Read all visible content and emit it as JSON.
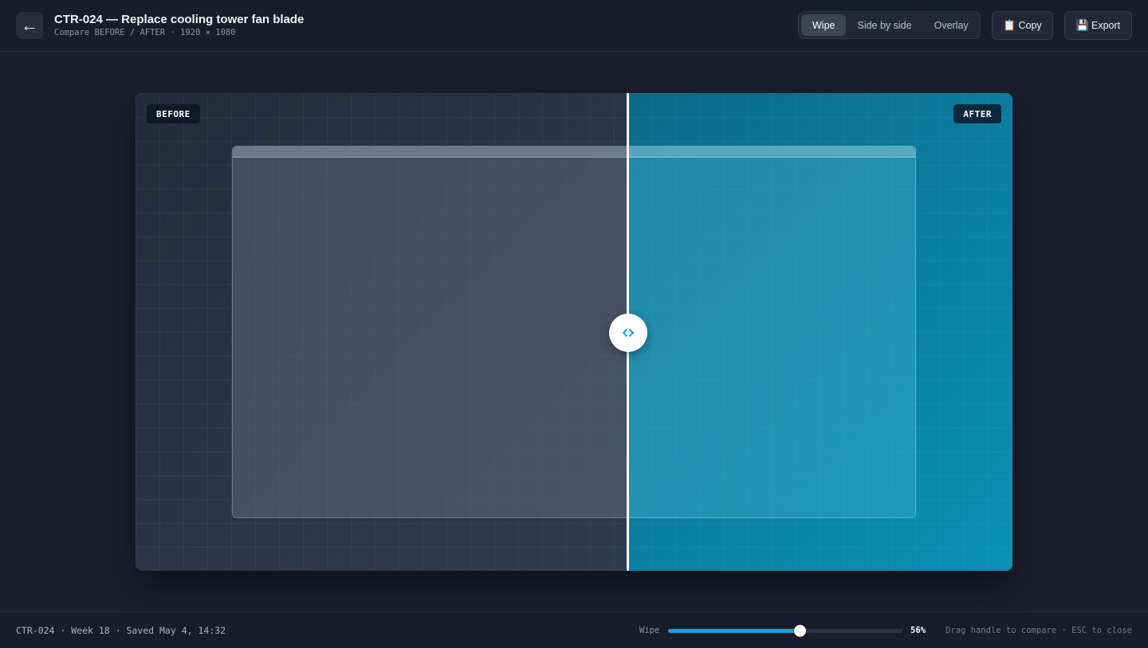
{
  "header": {
    "back_icon": "arrow-left-icon",
    "back_glyph": "←",
    "title": "CTR-024 — Replace cooling tower fan blade",
    "subtitle": "Compare BEFORE / AFTER · 1920 × 1080",
    "modes": [
      {
        "label": "Wipe",
        "active": true
      },
      {
        "label": "Side by side",
        "active": false
      },
      {
        "label": "Overlay",
        "active": false
      }
    ],
    "copy_icon": "clipboard-icon",
    "copy_glyph": "📋",
    "copy_label": "Copy",
    "export_icon": "floppy-disk-icon",
    "export_glyph": "💾",
    "export_label": "Export"
  },
  "stage": {
    "before_label": "BEFORE",
    "after_label": "AFTER",
    "handle_icon": "compare-arrows-icon",
    "accent_color": "#1aa0dc"
  },
  "footer": {
    "status": "CTR-024 · Week 18 · Saved May 4, 14:32",
    "wipe_label": "Wipe",
    "wipe_value": 0.56,
    "wipe_percent": "56%",
    "hint": "Drag handle to compare · ESC to close"
  }
}
